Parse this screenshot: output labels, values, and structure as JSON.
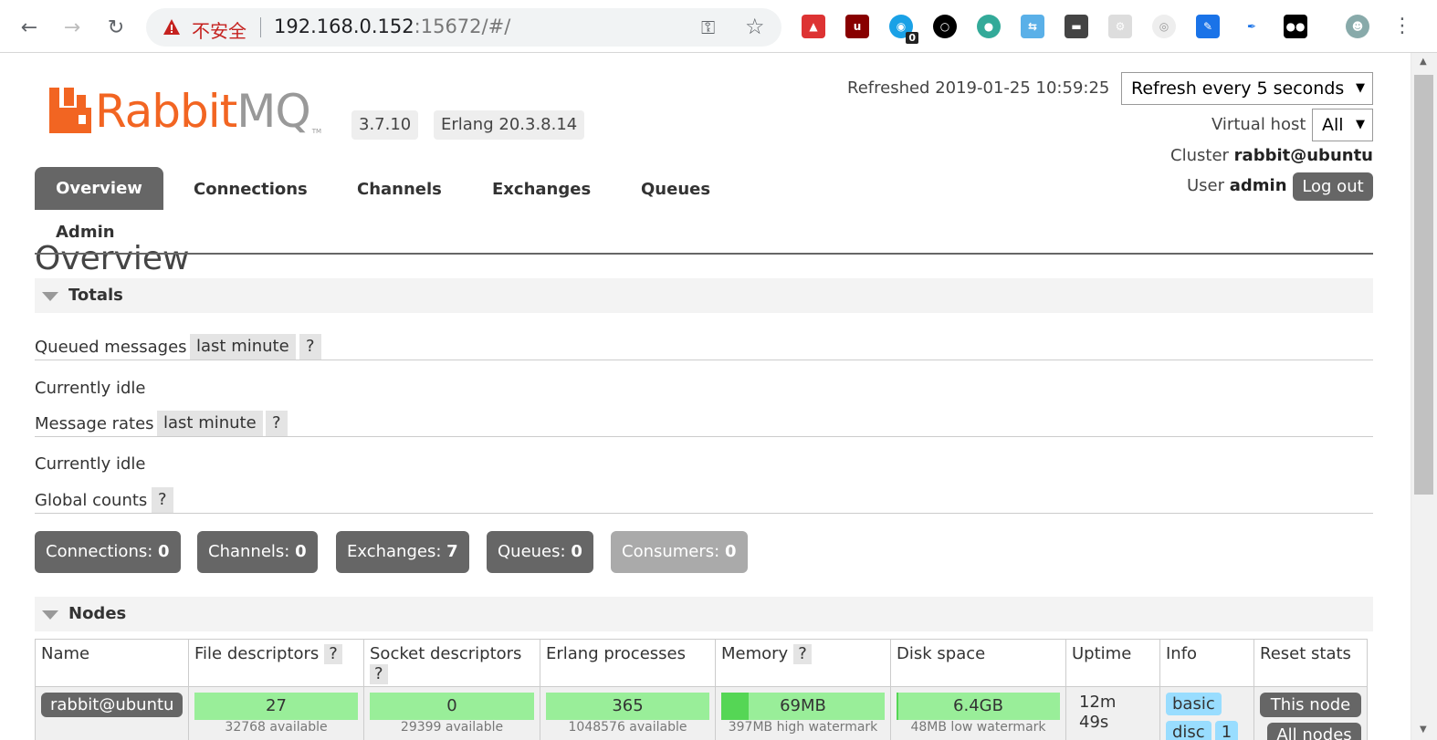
{
  "browser": {
    "insecure_label": "不安全",
    "url_host": "192.168.0.152",
    "url_rest": ":15672/#/",
    "extension_badge": "0"
  },
  "header": {
    "logo_text_a": "Rabbit",
    "logo_text_b": "MQ",
    "logo_tm": "TM",
    "version": "3.7.10",
    "erlang": "Erlang 20.3.8.14",
    "refreshed": "Refreshed 2019-01-25 10:59:25",
    "refresh_select": "Refresh every 5 seconds",
    "vhost_label": "Virtual host",
    "vhost_select": "All",
    "cluster_label": "Cluster",
    "cluster_value": "rabbit@ubuntu",
    "user_label": "User",
    "user_value": "admin",
    "logout": "Log out"
  },
  "tabs": [
    {
      "label": "Overview",
      "active": true
    },
    {
      "label": "Connections"
    },
    {
      "label": "Channels"
    },
    {
      "label": "Exchanges"
    },
    {
      "label": "Queues"
    },
    {
      "label": "Admin"
    }
  ],
  "page_title": "Overview",
  "totals": {
    "heading": "Totals",
    "queued_label": "Queued messages",
    "queued_range": "last minute",
    "help": "?",
    "queued_status": "Currently idle",
    "rates_label": "Message rates",
    "rates_range": "last minute",
    "rates_status": "Currently idle",
    "global_label": "Global counts",
    "counts": [
      {
        "label": "Connections:",
        "value": "0"
      },
      {
        "label": "Channels:",
        "value": "0"
      },
      {
        "label": "Exchanges:",
        "value": "7"
      },
      {
        "label": "Queues:",
        "value": "0"
      },
      {
        "label": "Consumers:",
        "value": "0"
      }
    ]
  },
  "nodes": {
    "heading": "Nodes",
    "columns": [
      "Name",
      "File descriptors",
      "Socket descriptors",
      "Erlang processes",
      "Memory",
      "Disk space",
      "Uptime",
      "Info",
      "Reset stats"
    ],
    "row": {
      "name": "rabbit@ubuntu",
      "file_descriptors": "27",
      "file_descriptors_sub": "32768 available",
      "socket_descriptors": "0",
      "socket_descriptors_sub": "29399 available",
      "erlang_processes": "365",
      "erlang_processes_sub": "1048576 available",
      "memory": "69MB",
      "memory_sub": "397MB high watermark",
      "memory_fraction": 0.17,
      "disk": "6.4GB",
      "disk_sub": "48MB low watermark",
      "uptime_a": "12m",
      "uptime_b": "49s",
      "info_tags": [
        "basic",
        "disc",
        "1"
      ],
      "reset_this": "This node",
      "reset_all": "All nodes"
    }
  }
}
